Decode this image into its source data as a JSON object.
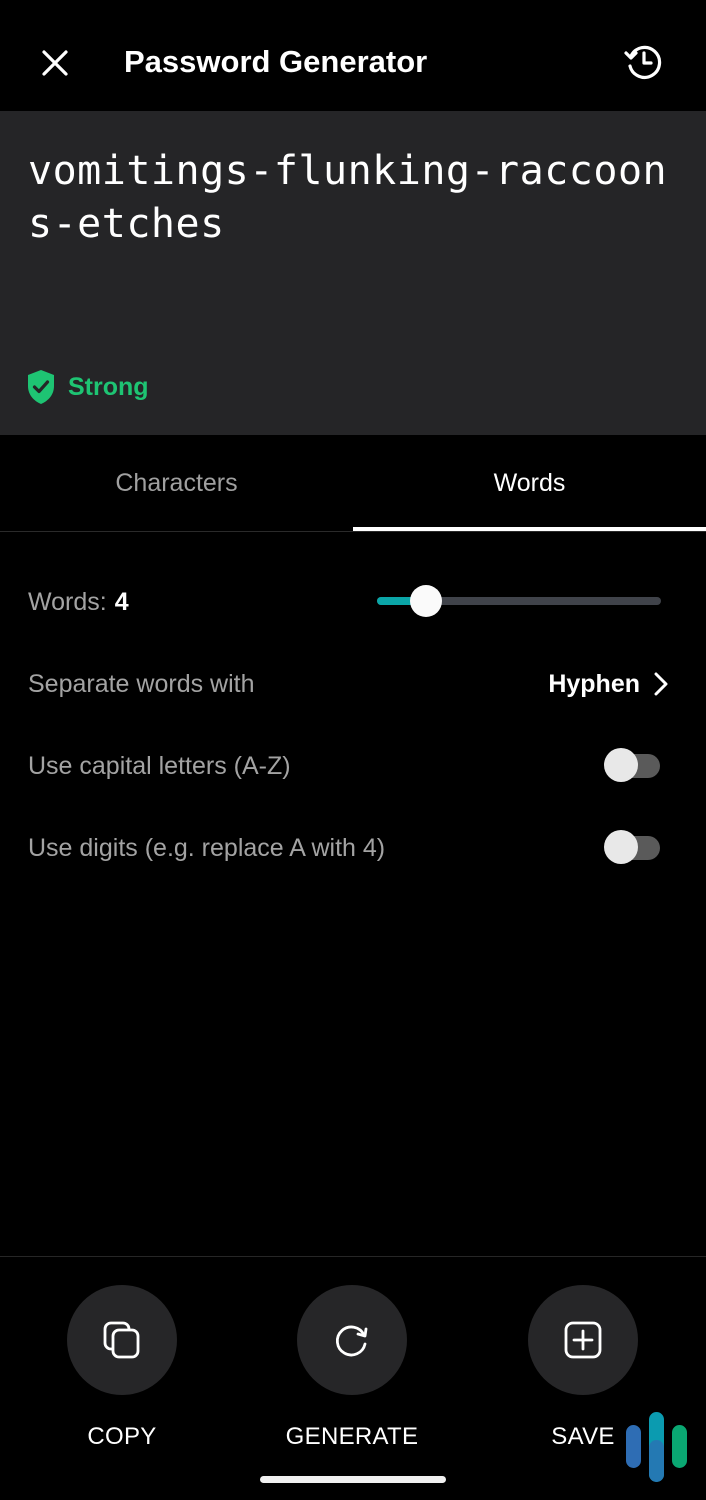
{
  "header": {
    "title": "Password Generator",
    "close_icon": "close-icon",
    "history_icon": "history-icon"
  },
  "password": {
    "value": "vomitings-flunking-raccoons-etches",
    "strength_label": "Strong",
    "strength_icon": "shield-check-icon",
    "strength_color": "#1ec473"
  },
  "tabs": [
    {
      "label": "Characters",
      "active": false
    },
    {
      "label": "Words",
      "active": true
    }
  ],
  "options": {
    "words_label": "Words:",
    "words_value": "4",
    "words_slider": {
      "value": 4,
      "fill_fraction": 0.15
    },
    "separator_label": "Separate words with",
    "separator_value": "Hyphen",
    "capitals_label": "Use capital letters (A-Z)",
    "capitals_enabled": false,
    "digits_label": "Use digits (e.g. replace A with 4)",
    "digits_enabled": false
  },
  "actions": [
    {
      "label": "COPY",
      "icon": "copy-icon"
    },
    {
      "label": "GENERATE",
      "icon": "refresh-icon"
    },
    {
      "label": "SAVE",
      "icon": "add-square-icon"
    }
  ],
  "colors": {
    "accent": "#0ba6a8",
    "background": "#000000",
    "panel": "#252527",
    "strong": "#1ec473"
  }
}
